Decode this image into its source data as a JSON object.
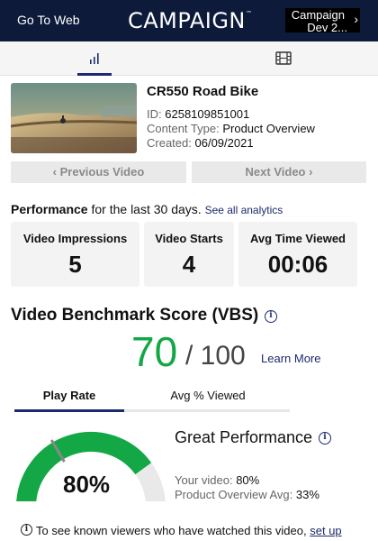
{
  "header": {
    "go_to_web": "Go To Web",
    "logo": "CAMPAIGN",
    "logo_tm": "™",
    "campaign_line1": "Campaign",
    "campaign_line2": "Dev 2...",
    "campaign_chevron": "›"
  },
  "tabs": {
    "stats_icon": "bar-chart-icon",
    "film_icon": "film-icon"
  },
  "video": {
    "title": "CR550 Road Bike",
    "id_label": "ID:",
    "id_value": "6258109851001",
    "content_type_label": "Content Type:",
    "content_type_value": "Product Overview",
    "created_label": "Created:",
    "created_value": "06/09/2021"
  },
  "nav": {
    "prev": "‹ Previous Video",
    "next": "Next Video ›"
  },
  "performance": {
    "label": "Performance",
    "period": " for the last 30 days.",
    "link": "See all analytics",
    "cards": [
      {
        "label": "Video Impressions",
        "value": "5"
      },
      {
        "label": "Video Starts",
        "value": "4"
      },
      {
        "label": "Avg Time Viewed",
        "value": "00:06"
      }
    ]
  },
  "vbs": {
    "title": "Video Benchmark Score (VBS)",
    "score": "70",
    "total": "/ 100",
    "learn_more": "Learn More",
    "tabs": [
      {
        "label": "Play Rate",
        "active": true
      },
      {
        "label": "Avg % Viewed",
        "active": false
      }
    ],
    "gauge_value": 0.8,
    "gauge_benchmark": 0.33,
    "gauge_label": "80%",
    "verdict": "Great Performance",
    "your_label": "Your video:",
    "your_value": "80%",
    "avg_label": "Product Overview Avg:",
    "avg_value": "33%"
  },
  "footer": {
    "text": "To see known viewers who have watched this video,",
    "link": "set up"
  },
  "colors": {
    "navy": "#0d1a3a",
    "accent": "#1d2a6b",
    "green": "#13a845"
  }
}
